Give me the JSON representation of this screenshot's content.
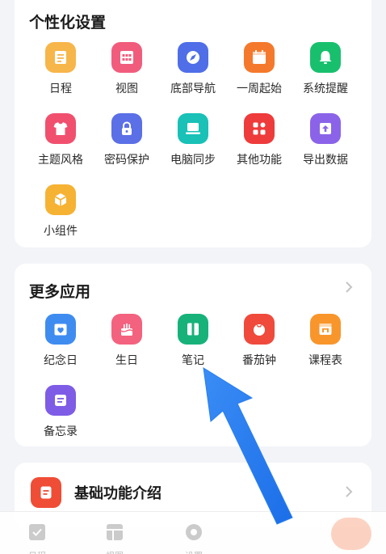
{
  "personalize": {
    "title": "个性化设置",
    "items": [
      {
        "label": "日程",
        "icon": "schedule-icon",
        "color": "#f7b64a"
      },
      {
        "label": "视图",
        "icon": "view-grid-icon",
        "color": "#f15c7c"
      },
      {
        "label": "底部导航",
        "icon": "compass-icon",
        "color": "#4f6ee8"
      },
      {
        "label": "一周起始",
        "icon": "calendar-icon",
        "color": "#f5792c"
      },
      {
        "label": "系统提醒",
        "icon": "bell-icon",
        "color": "#18c06e"
      },
      {
        "label": "主题风格",
        "icon": "tshirt-icon",
        "color": "#f0506e"
      },
      {
        "label": "密码保护",
        "icon": "lock-icon",
        "color": "#5b6fe6"
      },
      {
        "label": "电脑同步",
        "icon": "laptop-icon",
        "color": "#19c1b6"
      },
      {
        "label": "其他功能",
        "icon": "apps-icon",
        "color": "#ee3b3b"
      },
      {
        "label": "导出数据",
        "icon": "export-icon",
        "color": "#8b63e8"
      },
      {
        "label": "小组件",
        "icon": "widget-icon",
        "color": "#f6b233"
      }
    ]
  },
  "more_apps": {
    "title": "更多应用",
    "items": [
      {
        "label": "纪念日",
        "icon": "anniversary-icon",
        "color": "#3f8cf0"
      },
      {
        "label": "生日",
        "icon": "cake-icon",
        "color": "#f3627e"
      },
      {
        "label": "笔记",
        "icon": "notebook-icon",
        "color": "#17b27a"
      },
      {
        "label": "番茄钟",
        "icon": "tomato-icon",
        "color": "#ef4a3c"
      },
      {
        "label": "课程表",
        "icon": "timetable-icon",
        "color": "#f8962c"
      },
      {
        "label": "备忘录",
        "icon": "memo-icon",
        "color": "#7e5ce6"
      }
    ]
  },
  "basic_intro": {
    "label": "基础功能介绍",
    "icon": "document-icon",
    "color": "#ef4d36"
  },
  "tabbar": {
    "tabs": [
      {
        "label": "日程"
      },
      {
        "label": "视图"
      },
      {
        "label": "设置"
      }
    ]
  }
}
